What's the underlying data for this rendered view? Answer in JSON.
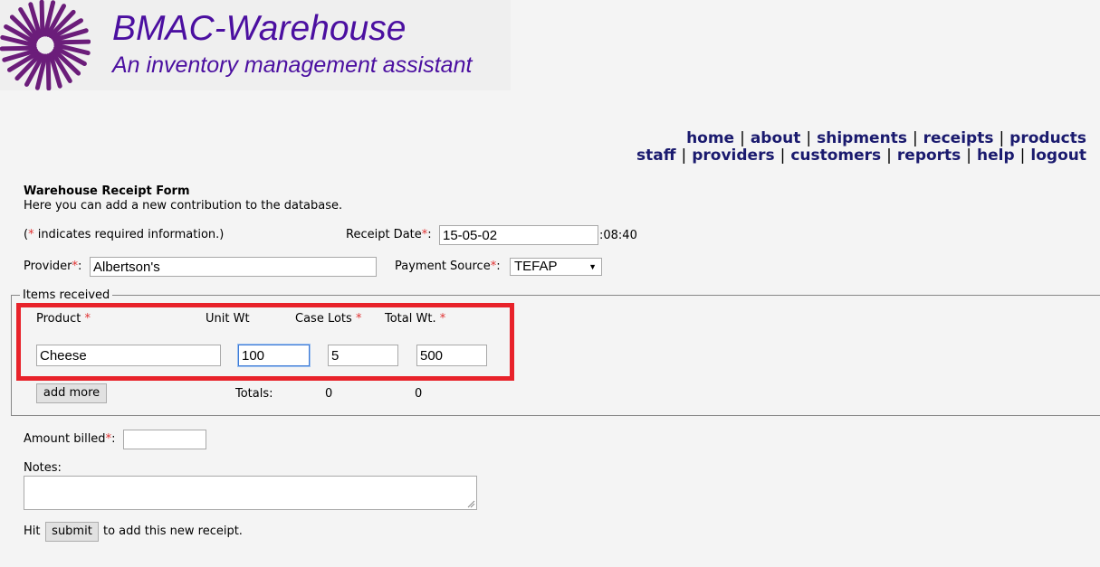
{
  "app": {
    "title": "BMAC-Warehouse",
    "subtitle": "An inventory management assistant",
    "brand_color": "#4b0fa0"
  },
  "nav": {
    "row1": [
      "home",
      "about",
      "shipments",
      "receipts",
      "products"
    ],
    "row2": [
      "staff",
      "providers",
      "customers",
      "reports",
      "help",
      "logout"
    ],
    "separator": "|"
  },
  "form": {
    "title": "Warehouse Receipt Form",
    "description": "Here you can add a new contribution to the database.",
    "required_note_open": "(",
    "required_star": "*",
    "required_note_text": " indicates required information.)",
    "receipt_date_label": "Receipt Date",
    "receipt_date_value": "15-05-02",
    "receipt_time": ":08:40",
    "provider_label": "Provider",
    "provider_value": "Albertson's",
    "payment_source_label": "Payment Source",
    "payment_source_value": "TEFAP",
    "colon": ":"
  },
  "items": {
    "legend": "Items received",
    "headers": {
      "product": "Product",
      "unit_wt": "Unit Wt",
      "case_lots": "Case Lots",
      "total_wt": "Total Wt."
    },
    "row": {
      "product": "Cheese",
      "unit_wt": "100",
      "case_lots": "5",
      "total_wt": "500"
    },
    "add_more_label": "add more",
    "totals_label": "Totals:",
    "totals_case_lots": "0",
    "totals_total_wt": "0",
    "highlight_color": "#e8222a"
  },
  "billing": {
    "amount_label": "Amount billed",
    "amount_value": "",
    "notes_label": "Notes:",
    "notes_value": ""
  },
  "submit": {
    "hit_text": "Hit",
    "button_label": "submit",
    "after_text": "to add this new receipt."
  }
}
